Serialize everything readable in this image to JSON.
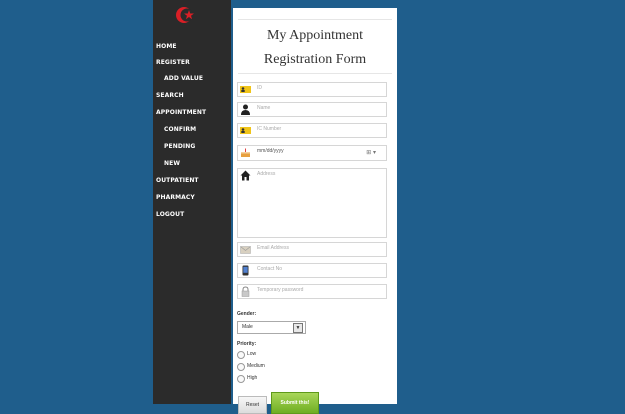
{
  "sidebar": {
    "items": [
      {
        "label": "HOME"
      },
      {
        "label": "REGISTER"
      },
      {
        "label": "ADD VALUE"
      },
      {
        "label": "SEARCH"
      },
      {
        "label": "APPOINTMENT"
      },
      {
        "label": "CONFIRM"
      },
      {
        "label": "PENDING"
      },
      {
        "label": "NEW"
      },
      {
        "label": "OUTPATIENT"
      },
      {
        "label": "PHARMACY"
      },
      {
        "label": "LOGOUT"
      }
    ]
  },
  "form": {
    "title_line1": "My Appointment",
    "title_line2": "Registration Form",
    "fields": {
      "id": "ID",
      "name": "Name",
      "ic_number": "IC Number",
      "date": "mm/dd/yyyy",
      "address": "Address",
      "email": "Email Address",
      "contact": "Contact No",
      "password": "Temporary password"
    },
    "gender_label": "Gender:",
    "gender_value": "Male",
    "priority_label": "Priority:",
    "priority_options": [
      "Low",
      "Medium",
      "High"
    ],
    "reset_label": "Reset",
    "submit_label": "Submit this!"
  },
  "colors": {
    "background": "#1f5e8c",
    "sidebar": "#2b2b2b",
    "submit": "#7cbb2c"
  }
}
